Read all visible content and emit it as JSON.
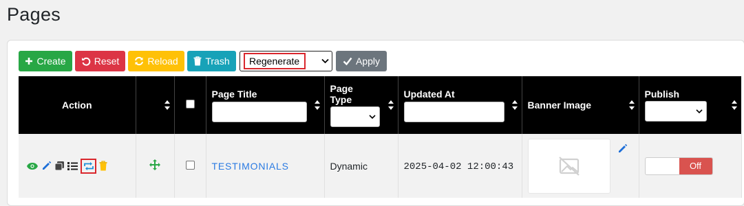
{
  "page": {
    "title": "Pages"
  },
  "toolbar": {
    "create_label": "Create",
    "reset_label": "Reset",
    "reload_label": "Reload",
    "trash_label": "Trash",
    "bulk_action_selected": "Regenerate",
    "apply_label": "Apply"
  },
  "table": {
    "headers": {
      "action": "Action",
      "page_title": "Page Title",
      "page_type_line1": "Page",
      "page_type_line2": "Type",
      "updated_at": "Updated At",
      "banner_image": "Banner Image",
      "publish": "Publish"
    },
    "rows": [
      {
        "page_title": "TESTIMONIALS",
        "page_type": "Dynamic",
        "updated_at": "2025-04-02 12:00:43",
        "publish_label": "Off",
        "action_icons": [
          "eye-icon",
          "pencil-icon",
          "copy-icon",
          "list-icon",
          "regenerate-icon",
          "trash-icon"
        ]
      }
    ]
  },
  "colors": {
    "create": "#28a745",
    "reset": "#dc3545",
    "reload": "#ffc107",
    "trash": "#17a2b8",
    "apply": "#6c757d",
    "header_bg": "#000000",
    "link": "#2a7ae2",
    "highlight": "#d9262c",
    "off": "#d9534f"
  }
}
